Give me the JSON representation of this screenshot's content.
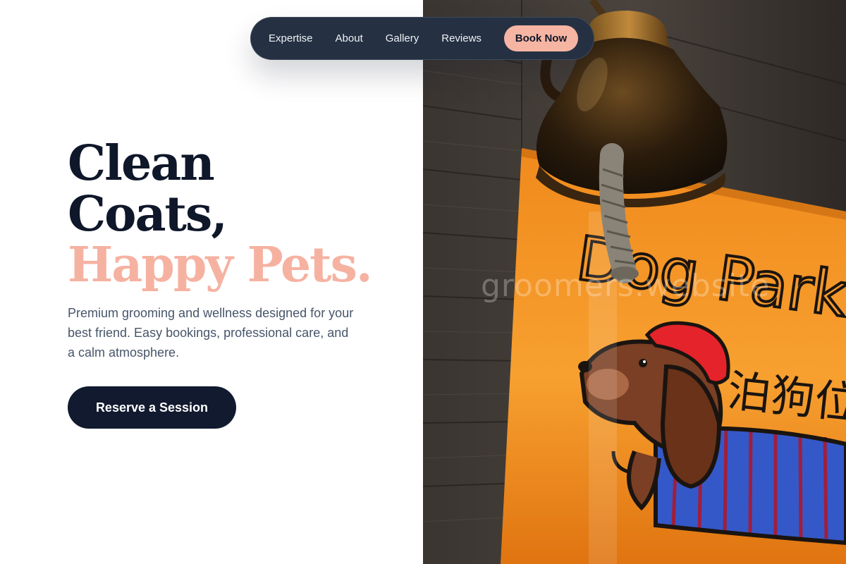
{
  "nav": {
    "links": [
      "Expertise",
      "About",
      "Gallery",
      "Reviews"
    ],
    "cta_label": "Book Now"
  },
  "hero": {
    "headline_line1": "Clean",
    "headline_line2": "Coats,",
    "headline_accent": "Happy Pets.",
    "description": "Premium grooming and wellness designed for your best friend. Easy bookings, professional care, and a calm atmosphere.",
    "cta_label": "Reserve a Session"
  },
  "image": {
    "watermark": "groomers.website",
    "sign_text": "Dog Parking 泊狗位"
  },
  "colors": {
    "navy": "#0f172a",
    "accent_peach": "#f6b2a1",
    "nav_bg": "#253142",
    "text_muted": "#475569",
    "sign_orange": "#f08a1c"
  }
}
